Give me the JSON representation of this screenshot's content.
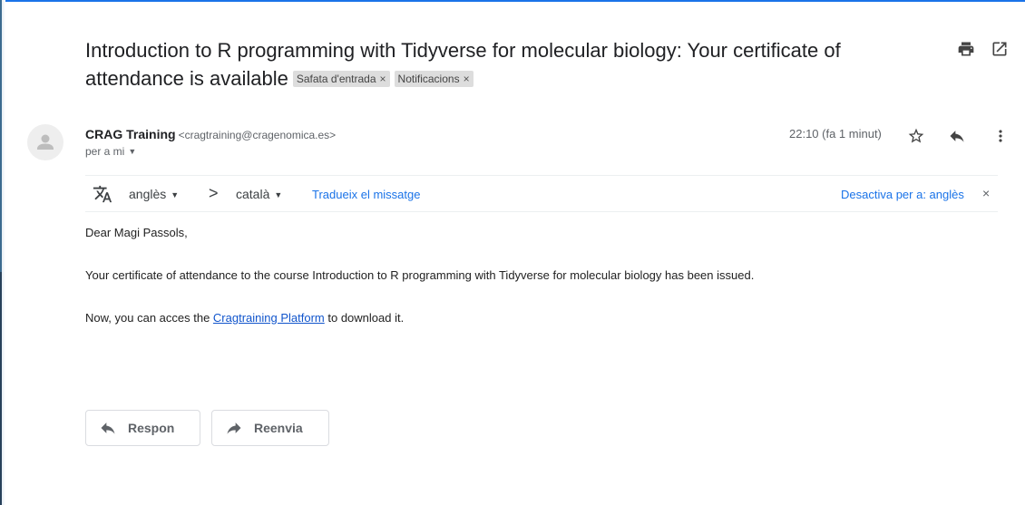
{
  "email": {
    "subject": "Introduction to R programming with Tidyverse for molecular biology: Your certificate of attendance is available",
    "labels": [
      {
        "name": "Safata d'entrada",
        "remove": "×"
      },
      {
        "name": "Notificacions",
        "remove": "×"
      }
    ],
    "sender": {
      "name": "CRAG Training",
      "email": "<cragtraining@cragenomica.es>"
    },
    "recipient": "per a mi",
    "timestamp": "22:10 (fa 1 minut)"
  },
  "translate": {
    "source_lang": "anglès",
    "arrow": ">",
    "target_lang": "català",
    "translate_link": "Tradueix el missatge",
    "disable_link": "Desactiva per a: anglès",
    "close": "×"
  },
  "body": {
    "greeting": "Dear Magi Passols,",
    "paragraph1": "Your certificate of attendance to the course Introduction to R programming with Tidyverse for molecular biology has been issued.",
    "paragraph2_before": "Now, you can acces the ",
    "paragraph2_link": "Cragtraining Platform",
    "paragraph2_after": " to download it."
  },
  "actions": {
    "reply_label": "Respon",
    "forward_label": "Reenvia"
  },
  "icons": {
    "print": "printer-icon",
    "open_new_window": "open-in-new-window-icon",
    "star": "star-icon",
    "reply": "reply-icon",
    "more": "more-vert-icon",
    "translate": "translate-icon",
    "avatar": "person-icon",
    "forward": "forward-icon"
  },
  "colors": {
    "link": "#1155cc",
    "accent": "#1a73e8",
    "label_chip_bg": "#dddddd"
  }
}
